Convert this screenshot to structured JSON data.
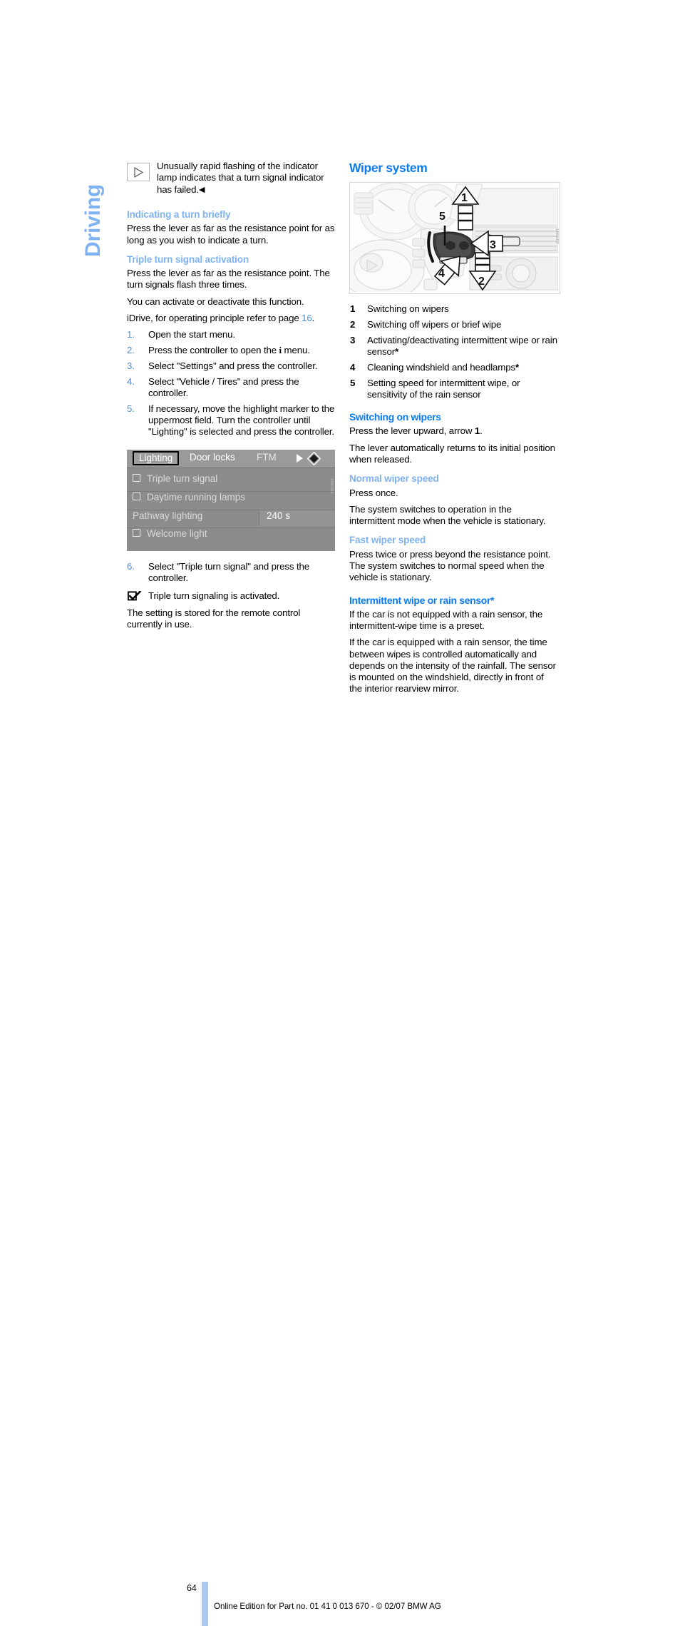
{
  "page": {
    "number": "64",
    "side_tab": "Driving",
    "footer_note": "Online Edition for Part no. 01 41 0 013 670 - © 02/07 BMW AG"
  },
  "left_column": {
    "note": {
      "icon": "play-triangle-icon",
      "text": "Unusually rapid flashing of the indicator lamp indicates that a turn signal indicator has failed.",
      "end_marker": "◀"
    },
    "sections": [
      {
        "heading": "Indicating a turn briefly",
        "paragraphs": [
          "Press the lever as far as the resistance point for as long as you wish to indicate a turn."
        ]
      },
      {
        "heading": "Triple turn signal activation",
        "paragraphs": [
          "Press the lever as far as the resistance point. The turn signals flash three times.",
          "You can activate or deactivate this function."
        ]
      }
    ],
    "idrive_intro_prefix": "iDrive, for operating principle refer to page ",
    "idrive_intro_page_ref": "16",
    "idrive_intro_suffix": ".",
    "steps": [
      {
        "num": "1.",
        "text": "Open the start menu."
      },
      {
        "num": "2.",
        "text_before": "Press the controller to open the ",
        "symbol": "i",
        "text_after": " menu."
      },
      {
        "num": "3.",
        "text": "Select \"Settings\" and press the controller."
      },
      {
        "num": "4.",
        "text": "Select \"Vehicle / Tires\" and press the controller."
      },
      {
        "num": "5.",
        "text": "If necessary, move the highlight marker to the uppermost field. Turn the controller until \"Lighting\" is selected and press the controller."
      }
    ],
    "idrive_screen": {
      "tabs": [
        {
          "label": "Lighting",
          "selected": true
        },
        {
          "label": "Door locks",
          "selected": false
        },
        {
          "label": "FTM",
          "selected": false
        }
      ],
      "nav_arrow_icon": "arrow-right-icon",
      "joystick_icon": "controller-diamond-icon",
      "rows": [
        {
          "label": "Triple turn signal",
          "checkbox": true,
          "value": ""
        },
        {
          "label": "Daytime running lamps",
          "checkbox": true,
          "value": ""
        },
        {
          "label": "Pathway lighting",
          "checkbox": false,
          "value": "240 s"
        },
        {
          "label": "Welcome light",
          "checkbox": true,
          "value": ""
        }
      ],
      "caption": "1ABGDE"
    },
    "step6": {
      "num": "6.",
      "text": "Select \"Triple turn signal\" and press the controller."
    },
    "check_result": {
      "icon": "checkbox-checked-icon",
      "text": "Triple turn signaling is activated."
    },
    "closing_paragraph": "The setting is stored for the remote control currently in use."
  },
  "right_column": {
    "title": "Wiper system",
    "illustration": {
      "name": "wiper-stalk-illustration",
      "callouts": [
        "1",
        "2",
        "3",
        "4",
        "5"
      ],
      "caption": "1ABGDF"
    },
    "legend": [
      {
        "n": "1",
        "text": "Switching on wipers",
        "star": false
      },
      {
        "n": "2",
        "text": "Switching off wipers or brief wipe",
        "star": false
      },
      {
        "n": "3",
        "text": "Activating/deactivating intermittent wipe or rain sensor",
        "star": true
      },
      {
        "n": "4",
        "text": "Cleaning windshield and headlamps",
        "star": true
      },
      {
        "n": "5",
        "text": "Setting speed for intermittent wipe, or sensitivity of the rain sensor",
        "star": false
      }
    ],
    "sections": [
      {
        "heading": "Switching on wipers",
        "level": "h2",
        "paragraphs_pre": "Press the lever upward, arrow ",
        "bold_token": "1",
        "paragraphs_post": ".",
        "paragraphs": [
          "The lever automatically returns to its initial position when released."
        ]
      },
      {
        "heading": "Normal wiper speed",
        "level": "h3",
        "paragraphs": [
          "Press once.",
          "The system switches to operation in the intermittent mode when the vehicle is stationary."
        ]
      },
      {
        "heading": "Fast wiper speed",
        "level": "h3",
        "paragraphs": [
          "Press twice or press beyond the resistance point.",
          "The system switches to normal speed when the vehicle is stationary."
        ]
      },
      {
        "heading": "Intermittent wipe or rain sensor*",
        "level": "h2",
        "paragraphs": [
          "If the car is not equipped with a rain sensor, the intermittent-wipe time is a preset.",
          "If the car is equipped with a rain sensor, the time between wipes is controlled automatically and depends on the intensity of the rainfall. The sensor is mounted on the windshield, directly in front of the interior rearview mirror."
        ]
      }
    ]
  },
  "colors": {
    "heading_primary": "#0b7cf0",
    "heading_secondary": "#7fb2f2",
    "reference_link": "#4f8fe0",
    "footer_bar": "#a9c9f2"
  }
}
